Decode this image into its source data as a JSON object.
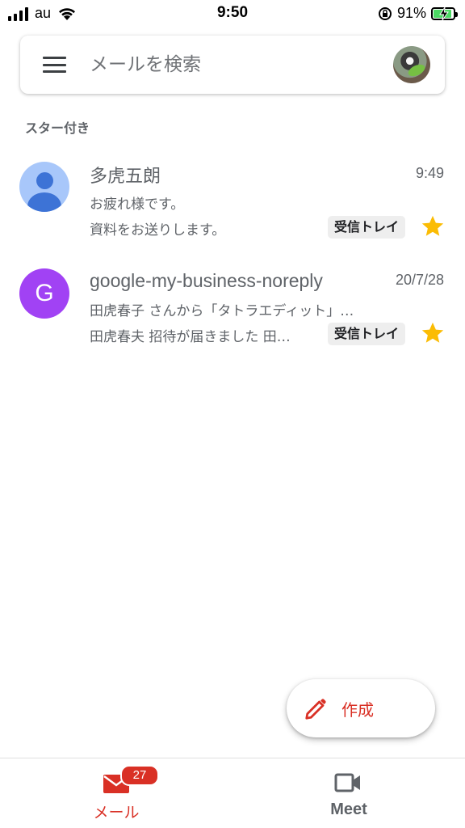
{
  "status_bar": {
    "carrier": "au",
    "time": "9:50",
    "battery_percent": "91%",
    "battery_level": 0.91,
    "signal_icon": "signal-bars-icon",
    "wifi_icon": "wifi-icon",
    "rotation_lock_icon": "rotation-lock-icon",
    "charging": true
  },
  "search": {
    "placeholder": "メールを検索",
    "menu_icon": "hamburger-menu-icon"
  },
  "section": {
    "label": "スター付き"
  },
  "emails": [
    {
      "sender": "多虎五朗",
      "time": "9:49",
      "subject": "お疲れ様です。",
      "snippet": "資料をお送りします。",
      "label": "受信トレイ",
      "starred": true,
      "avatar_type": "person-icon",
      "avatar_color": "#a8c7fa"
    },
    {
      "sender": "google-my-business-noreply",
      "time": "20/7/28",
      "subject": "田虎春子 さんから「タトラエディット」…",
      "snippet": "田虎春夫 招待が届きました 田…",
      "label": "受信トレイ",
      "starred": true,
      "avatar_letter": "G",
      "avatar_color": "#a142f4"
    }
  ],
  "compose": {
    "label": "作成",
    "icon": "pencil-icon"
  },
  "bottom_nav": {
    "mail_label": "メール",
    "mail_badge": "27",
    "meet_label": "Meet"
  },
  "colors": {
    "accent_red": "#d93025",
    "star_yellow": "#fbbc04",
    "text_grey": "#5f6368"
  }
}
